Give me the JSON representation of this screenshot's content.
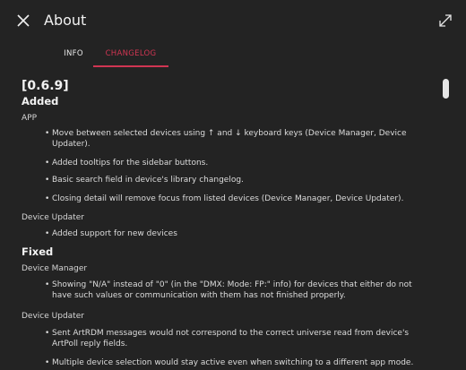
{
  "window": {
    "title": "About",
    "close_icon": "close-icon",
    "expand_icon": "expand-icon"
  },
  "tabs": [
    {
      "label": "INFO",
      "active": false
    },
    {
      "label": "CHANGELOG",
      "active": true
    }
  ],
  "colors": {
    "background": "#232323",
    "accent": "#d03552"
  },
  "changelog": {
    "version": "[0.6.9]",
    "added_heading": "Added",
    "added_groups": [
      {
        "name": "APP",
        "items": [
          "Move between selected devices using ↑ and ↓ keyboard keys (Device Manager, Device Updater).",
          "Added tooltips for the sidebar buttons.",
          "Basic search field in device's library changelog.",
          "Closing detail will remove focus from listed devices (Device Manager, Device Updater)."
        ]
      },
      {
        "name": "Device Updater",
        "items": [
          "Added support for new devices"
        ]
      }
    ],
    "fixed_heading": "Fixed",
    "fixed_groups": [
      {
        "name": "Device Manager",
        "items": [
          "Showing \"N/A\" instead of \"0\" (in the \"DMX: Mode: FP:\" info) for devices that either do not have such values or communication with them has not finished properly."
        ]
      },
      {
        "name": "Device Updater",
        "items": [
          "Sent ArtRDM messages would not correspond to the correct universe read from device's ArtPoll reply fields.",
          "Multiple device selection would stay active even when switching to a different app mode."
        ]
      }
    ]
  }
}
